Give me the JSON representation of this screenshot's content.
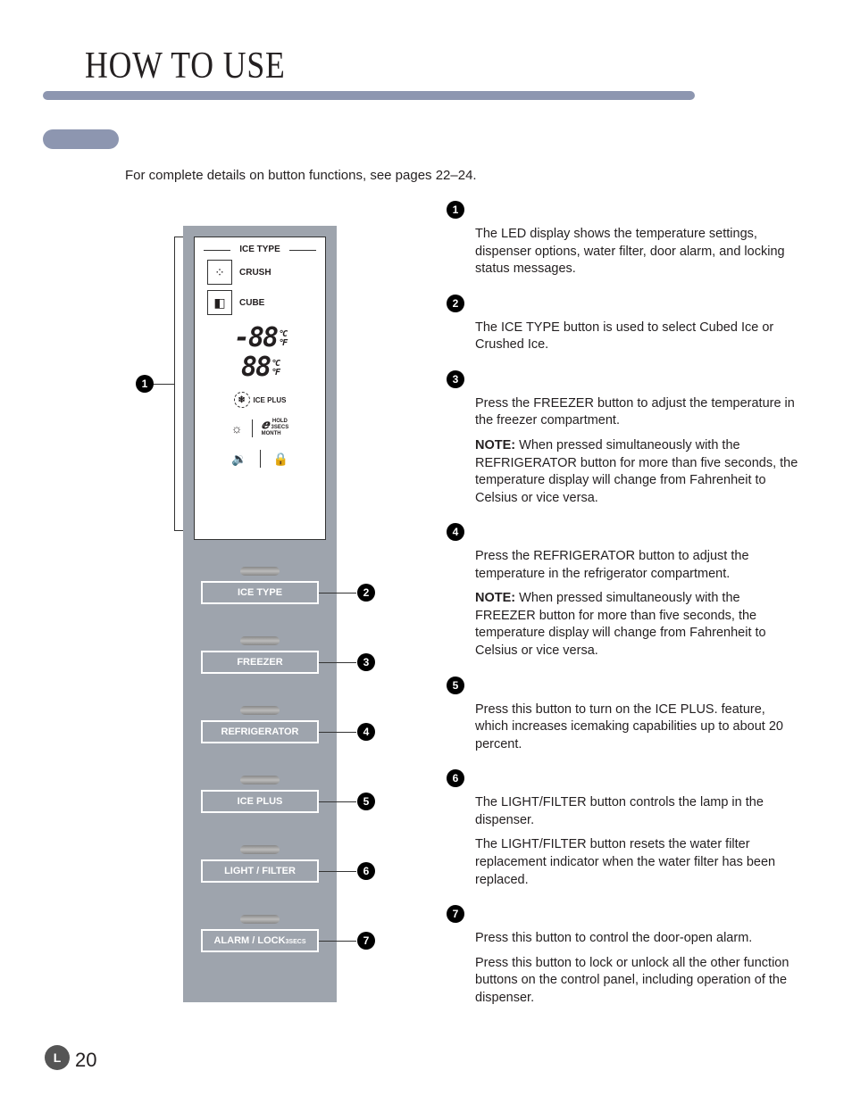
{
  "title": "HOW TO USE",
  "intro": "For complete details on button functions, see pages 22–24.",
  "display": {
    "ice_type_header": "ICE TYPE",
    "crush": "CRUSH",
    "cube": "CUBE",
    "temp1": "-88",
    "temp2": "88",
    "unit_c": "°C",
    "unit_f": "°F",
    "iceplus": "ICE PLUS",
    "hold": "HOLD",
    "secs": "3SECS",
    "month": "MONTH"
  },
  "buttons": [
    {
      "label": "ICE TYPE",
      "callout": "2"
    },
    {
      "label": "FREEZER",
      "callout": "3"
    },
    {
      "label": "REFRIGERATOR",
      "callout": "4"
    },
    {
      "label": "ICE PLUS",
      "callout": "5"
    },
    {
      "label": "LIGHT / FILTER",
      "callout": "6"
    },
    {
      "label": "ALARM / LOCK",
      "secs": "3SECS",
      "callout": "7"
    }
  ],
  "callout1": "1",
  "items": [
    {
      "n": "1",
      "paras": [
        "The LED display shows the temperature settings, dispenser options, water filter, door alarm, and locking status messages."
      ]
    },
    {
      "n": "2",
      "paras": [
        "The ICE TYPE button is used to select Cubed Ice or Crushed Ice."
      ]
    },
    {
      "n": "3",
      "paras": [
        "Press the FREEZER button to adjust the temperature in the freezer compartment."
      ],
      "note": "When pressed simultaneously with the REFRIGERATOR button for more than five seconds, the temperature display will change from Fahrenheit to Celsius or vice versa."
    },
    {
      "n": "4",
      "paras": [
        "Press the REFRIGERATOR button to adjust the temperature in the refrigerator compartment."
      ],
      "note": "When pressed simultaneously with the FREEZER button for more than five seconds, the temperature display will change from Fahrenheit to Celsius or vice versa."
    },
    {
      "n": "5",
      "paras": [
        "Press this button to turn on the ICE PLUS. feature, which increases icemaking capabilities up to about 20 percent."
      ]
    },
    {
      "n": "6",
      "paras": [
        "The LIGHT/FILTER button controls the lamp in the dispenser.",
        "The LIGHT/FILTER button resets the water filter replacement indicator when the water filter has been replaced."
      ]
    },
    {
      "n": "7",
      "paras": [
        "Press this button to control the door-open alarm.",
        "Press this button to lock or unlock all the other function buttons on the control panel, including operation of the dispenser."
      ]
    }
  ],
  "note_label": "NOTE:",
  "page_number": "20",
  "logo": "L"
}
